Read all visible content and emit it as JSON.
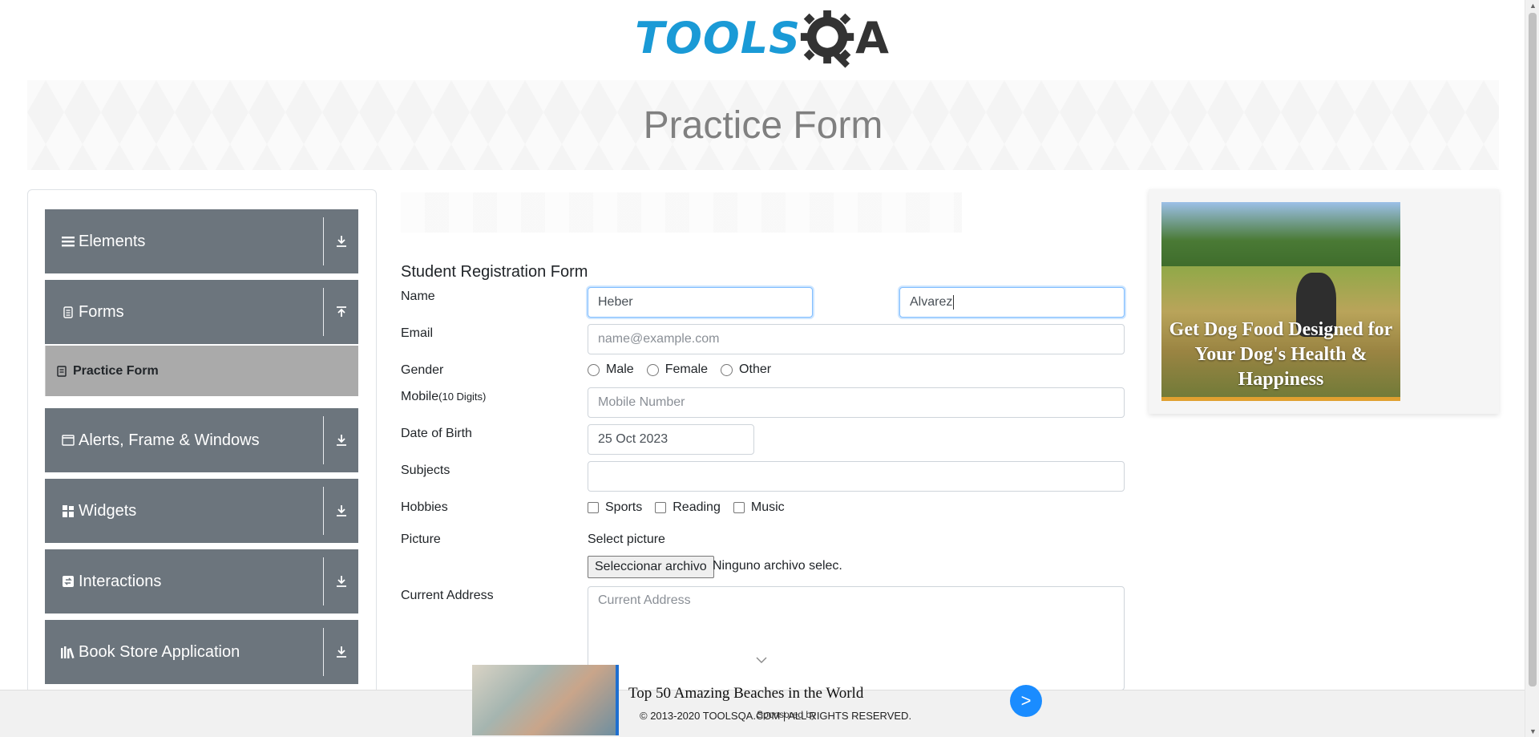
{
  "header": {
    "logo_tools": "TOOLS",
    "logo_a": "A"
  },
  "banner": {
    "title": "Practice Form"
  },
  "sidebar": {
    "groups": [
      {
        "label": "Elements",
        "icon": "list-icon",
        "arrow": "download-icon"
      },
      {
        "label": "Forms",
        "icon": "document-icon",
        "arrow": "upload-icon"
      },
      {
        "label": "Alerts, Frame & Windows",
        "icon": "window-icon",
        "arrow": "download-icon"
      },
      {
        "label": "Widgets",
        "icon": "grid-icon",
        "arrow": "download-icon"
      },
      {
        "label": "Interactions",
        "icon": "interaction-icon",
        "arrow": "download-icon"
      },
      {
        "label": "Book Store Application",
        "icon": "books-icon",
        "arrow": "download-icon"
      }
    ],
    "active_item": "Practice Form"
  },
  "form": {
    "title": "Student Registration Form",
    "name_label": "Name",
    "first_name_value": "Heber",
    "last_name_value": "Alvarez",
    "email_label": "Email",
    "email_placeholder": "name@example.com",
    "gender_label": "Gender",
    "gender_options": [
      "Male",
      "Female",
      "Other"
    ],
    "mobile_label": "Mobile",
    "mobile_hint": "(10 Digits)",
    "mobile_placeholder": "Mobile Number",
    "dob_label": "Date of Birth",
    "dob_value": "25 Oct 2023",
    "subjects_label": "Subjects",
    "hobbies_label": "Hobbies",
    "hobbies_options": [
      "Sports",
      "Reading",
      "Music"
    ],
    "picture_label": "Picture",
    "picture_caption": "Select picture",
    "file_button": "Seleccionar archivo",
    "file_status": "Ninguno archivo selec.",
    "address_label": "Current Address",
    "address_placeholder": "Current Address"
  },
  "side_ad": {
    "text": "Get Dog Food Designed for Your Dog's Health & Happiness"
  },
  "bottom_ad": {
    "headline": "Top 50 Amazing Beaches in the World",
    "sponsor": "Sponsored by",
    "cta": ">"
  },
  "footer": {
    "copyright": "© 2013-2020 TOOLSQA.COM | ALL RIGHTS RESERVED."
  },
  "colors": {
    "sidebar_bg": "#6c757d",
    "active_item_bg": "#aaaaaa",
    "logo_blue": "#1a9ad6",
    "cta_blue": "#1a8cff"
  }
}
